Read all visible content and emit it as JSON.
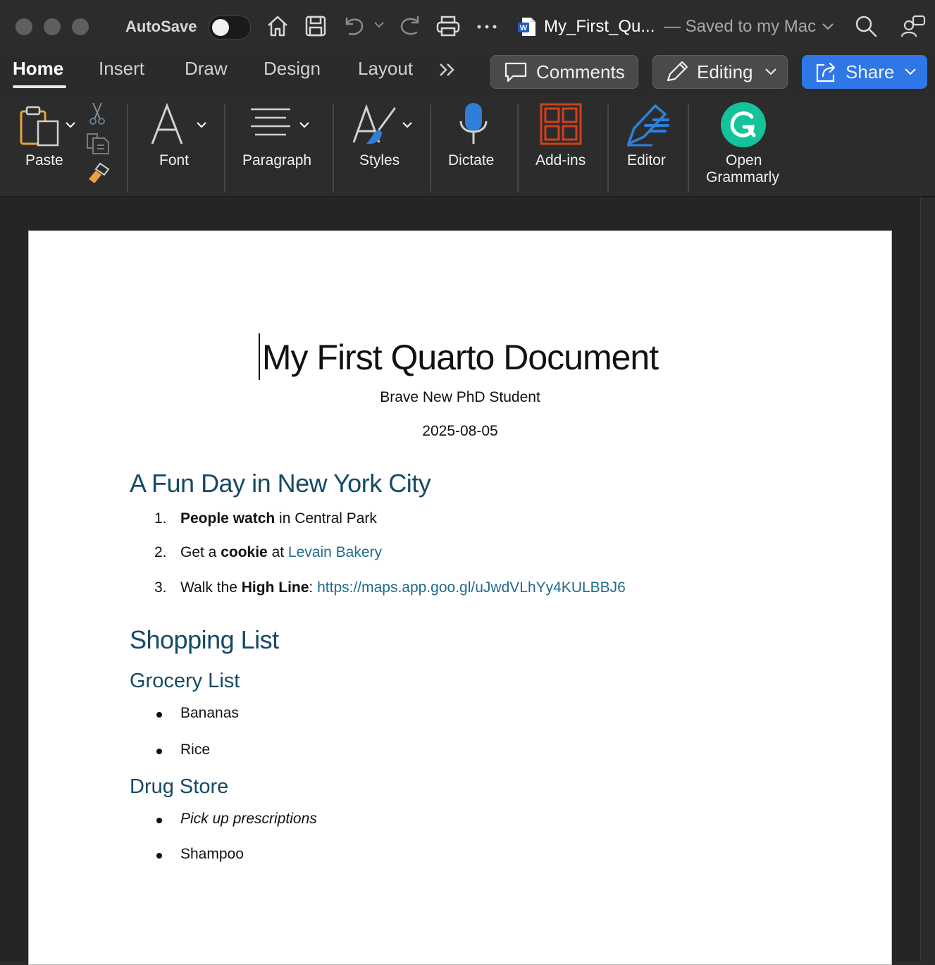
{
  "titlebar": {
    "autosave_label": "AutoSave",
    "autosave_on": false,
    "filename": "My_First_Qu...",
    "save_status": "— Saved to my Mac"
  },
  "tabs": [
    {
      "label": "Home",
      "active": true
    },
    {
      "label": "Insert"
    },
    {
      "label": "Draw"
    },
    {
      "label": "Design"
    },
    {
      "label": "Layout"
    }
  ],
  "buttons": {
    "comments": "Comments",
    "editing": "Editing",
    "share": "Share"
  },
  "ribbon": {
    "paste": "Paste",
    "font": "Font",
    "paragraph": "Paragraph",
    "styles": "Styles",
    "dictate": "Dictate",
    "addins": "Add-ins",
    "editor": "Editor",
    "grammarly_line1": "Open",
    "grammarly_line2": "Grammarly"
  },
  "document": {
    "title": "My First Quarto Document",
    "author": "Brave New PhD Student",
    "date": "2025-08-05",
    "section1": {
      "heading": "A Fun Day in New York City",
      "items": [
        {
          "num": "1.",
          "bold": "People watch",
          "rest": " in Central Park"
        },
        {
          "num": "2.",
          "pre": "Get a ",
          "bold": "cookie",
          "mid": " at ",
          "link": "Levain Bakery"
        },
        {
          "num": "3.",
          "pre": "Walk the ",
          "bold": "High Line",
          "mid": ": ",
          "link": "https://maps.app.goo.gl/uJwdVLhYy4KULBBJ6"
        }
      ]
    },
    "section2": {
      "heading": "Shopping List",
      "grocery": {
        "heading": "Grocery List",
        "items": [
          "Bananas",
          "Rice"
        ]
      },
      "drugstore": {
        "heading": "Drug Store",
        "items": [
          "Pick up prescriptions",
          "Shampoo"
        ]
      }
    }
  },
  "colors": {
    "heading": "#164a64",
    "link": "#1f6a8c",
    "share": "#2f76e6",
    "grammarly": "#15c39a",
    "addins": "#d2401b",
    "accent_blue": "#2f7fd8"
  }
}
